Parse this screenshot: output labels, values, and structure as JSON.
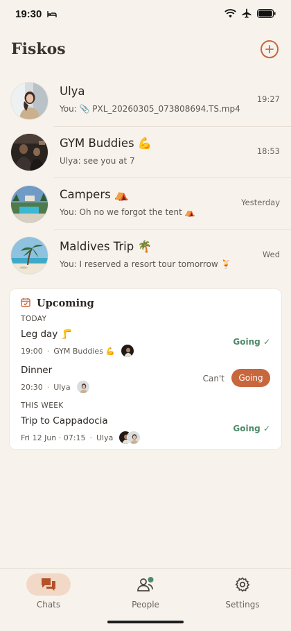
{
  "status_bar": {
    "time": "19:30"
  },
  "header": {
    "title": "Fiskos",
    "add_icon": "plus-circle-icon",
    "accent": "#c8663d"
  },
  "chats": [
    {
      "name": "Ulya",
      "preview": "You: 📎 PXL_20260305_073808694.TS.mp4",
      "time": "19:27",
      "avatar": "person-portrait"
    },
    {
      "name": "GYM Buddies 💪",
      "preview": "Ulya: see you at 7",
      "time": "18:53",
      "avatar": "gym-photo"
    },
    {
      "name": "Campers ⛺",
      "preview": "You: Oh no we forgot the tent ⛺",
      "time": "Yesterday",
      "avatar": "resort-photo"
    },
    {
      "name": "Maldives Trip 🌴",
      "preview": "You: I reserved a resort tour tomorrow 🍹",
      "time": "Wed",
      "avatar": "beach-photo"
    }
  ],
  "upcoming": {
    "title": "Upcoming",
    "sections": {
      "today": "TODAY",
      "this_week": "THIS WEEK"
    },
    "events": [
      {
        "title": "Leg day 🦵",
        "time": "19:00",
        "group": "GYM Buddies 💪",
        "status": "Going ✓"
      },
      {
        "title": "Dinner",
        "time": "20:30",
        "group": "Ulya",
        "cant_label": "Can't",
        "going_label": "Going"
      },
      {
        "title": "Trip to Cappadocia",
        "time": "Fri 12 Jun · 07:15",
        "group": "Ulya",
        "status": "Going ✓"
      }
    ],
    "going_color": "#4f8a6b"
  },
  "nav": {
    "items": [
      {
        "label": "Chats",
        "icon": "chat-bubbles-icon",
        "active": true
      },
      {
        "label": "People",
        "icon": "people-icon"
      },
      {
        "label": "Settings",
        "icon": "gear-icon"
      }
    ]
  }
}
